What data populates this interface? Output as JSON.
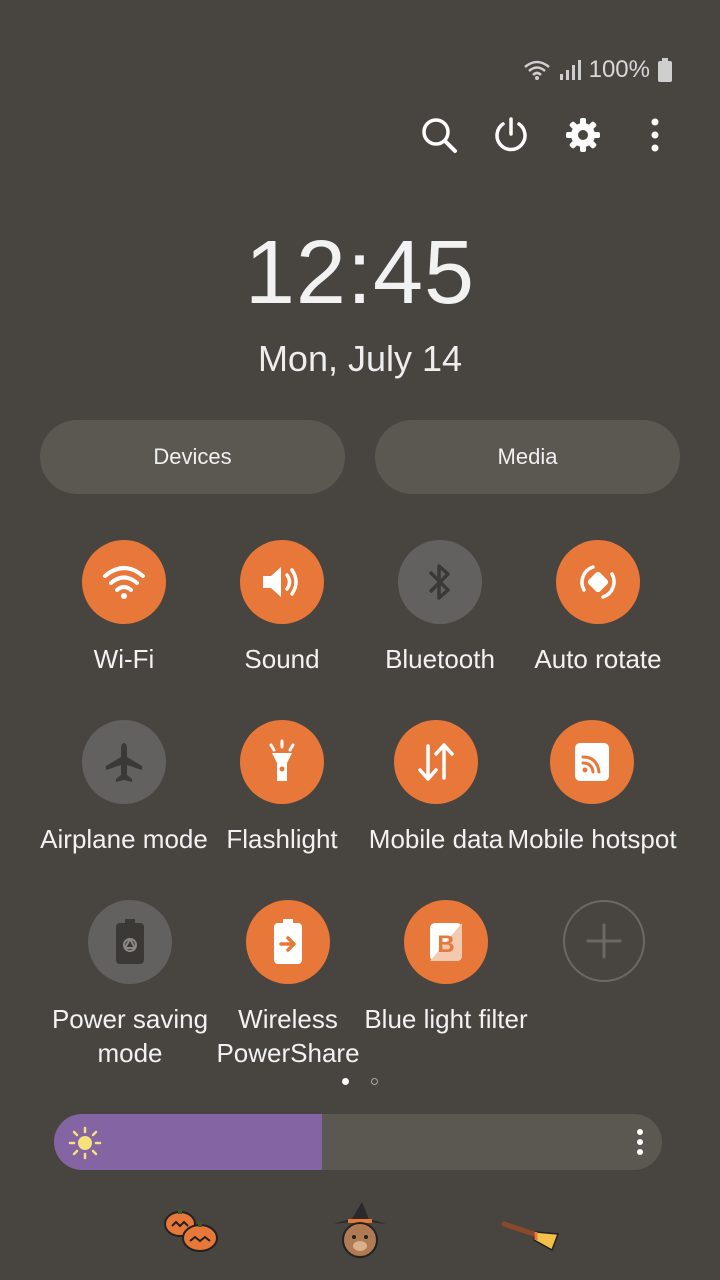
{
  "status": {
    "battery_text": "100%",
    "icons": [
      "wifi-icon",
      "signal-icon",
      "battery-icon"
    ]
  },
  "top_actions": [
    "search-icon",
    "power-icon",
    "gear-icon",
    "more-vert-icon"
  ],
  "clock": {
    "time": "12:45",
    "date": "Mon, July 14"
  },
  "pills": {
    "devices": "Devices",
    "media": "Media"
  },
  "tiles": [
    {
      "label": "Wi-Fi",
      "icon": "wifi-icon",
      "state": "on"
    },
    {
      "label": "Sound",
      "icon": "volume-icon",
      "state": "on"
    },
    {
      "label": "Bluetooth",
      "icon": "bluetooth-icon",
      "state": "off"
    },
    {
      "label": "Auto rotate",
      "icon": "rotate-icon",
      "state": "on"
    },
    {
      "label": "Airplane mode",
      "icon": "airplane-icon",
      "state": "off"
    },
    {
      "label": "Flashlight",
      "icon": "flashlight-icon",
      "state": "on"
    },
    {
      "label": "Mobile data",
      "icon": "data-arrows-icon",
      "state": "on"
    },
    {
      "label": "Mobile hotspot",
      "icon": "hotspot-icon",
      "state": "on"
    },
    {
      "label": "Power saving mode",
      "icon": "power-saving-icon",
      "state": "off"
    },
    {
      "label": "Wireless PowerShare",
      "icon": "powershare-icon",
      "state": "on"
    },
    {
      "label": "Blue light filter",
      "icon": "blue-light-icon",
      "state": "on"
    },
    {
      "label": "",
      "icon": "add-icon",
      "state": "empty"
    }
  ],
  "pager": {
    "current_page": 1,
    "page_count": 2
  },
  "brightness": {
    "level": 0.44,
    "fill_color": "#8464a3"
  },
  "colors": {
    "background": "#48443f",
    "tile_on": "#e8773a",
    "tile_off": "#636160"
  },
  "stickers": [
    "pumpkins-sticker",
    "witch-hat-bear-sticker",
    "broom-sticker"
  ]
}
